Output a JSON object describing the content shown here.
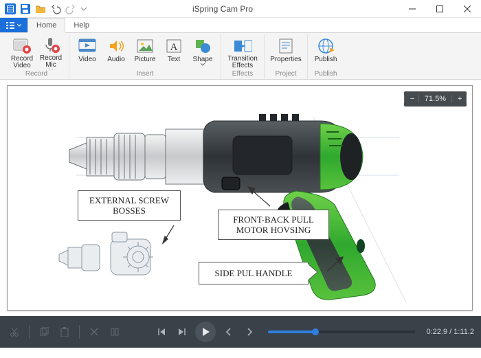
{
  "window": {
    "title": "iSpring Cam Pro"
  },
  "tabs": {
    "file": "",
    "home": "Home",
    "help": "Help"
  },
  "ribbon": {
    "record": {
      "video": "Record\nVideo",
      "mic": "Record\nMic",
      "group": "Record"
    },
    "insert": {
      "video": "Video",
      "audio": "Audio",
      "picture": "Picture",
      "text": "Text",
      "shape": "Shape",
      "group": "Insert"
    },
    "effects": {
      "transition": "Transition\nEffects",
      "group": "Effects"
    },
    "project": {
      "properties": "Properties",
      "group": "Project"
    },
    "publish": {
      "publish": "Publish",
      "group": "Publish"
    }
  },
  "canvas": {
    "zoom": "71.5%",
    "annotations": {
      "screw": "EXTERNAL SCREW\nBOSSES",
      "front": "FRONT-BACK PULL\nMOTOR HOVSING",
      "side": "SIDE PUL HANDLE"
    }
  },
  "timeline": {
    "current": "0:22.9",
    "total": "1:11.2",
    "progress_pct": 32
  }
}
